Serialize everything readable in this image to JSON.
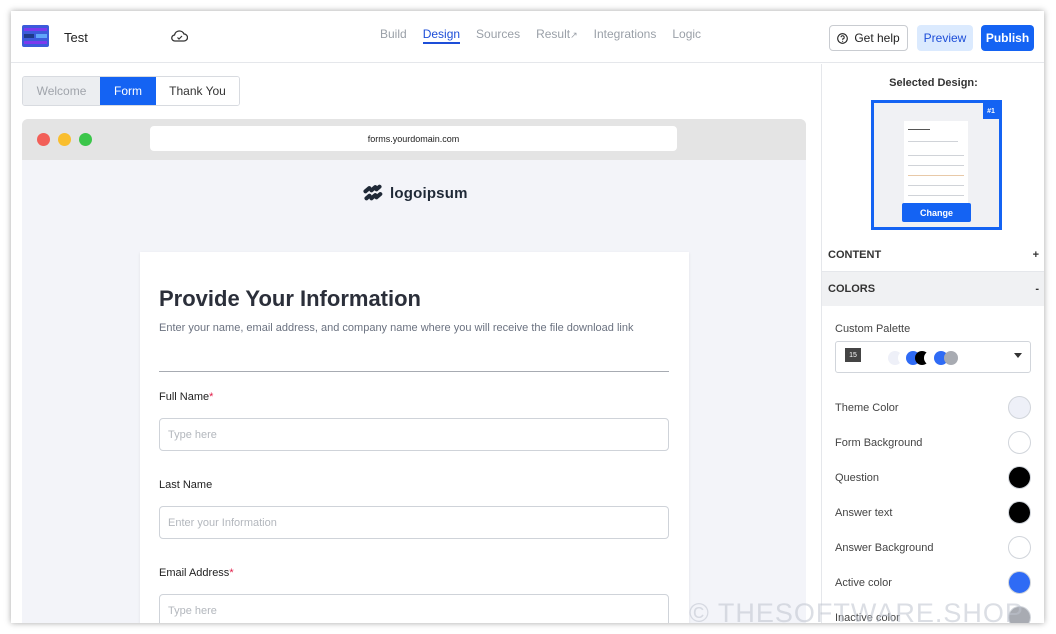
{
  "app": {
    "project_name": "Test"
  },
  "nav": [
    {
      "label": "Build"
    },
    {
      "label": "Design"
    },
    {
      "label": "Sources"
    },
    {
      "label": "Result"
    },
    {
      "label": "Integrations"
    },
    {
      "label": "Logic"
    }
  ],
  "actions": {
    "help": "Get help",
    "preview": "Preview",
    "publish": "Publish"
  },
  "page_tabs": [
    "Welcome",
    "Form",
    "Thank You"
  ],
  "browser": {
    "url": "forms.yourdomain.com"
  },
  "brand": {
    "name": "logoipsum"
  },
  "form": {
    "title": "Provide Your Information",
    "subtitle": "Enter your name, email address, and company name where you will receive the file download link",
    "fields": [
      {
        "label": "Full Name",
        "required": "*",
        "placeholder": "Type here"
      },
      {
        "label": "Last Name",
        "required": "",
        "placeholder": "Enter your Information"
      },
      {
        "label": "Email Address",
        "required": "*",
        "placeholder": "Type here"
      }
    ]
  },
  "panel": {
    "selected_design_title": "Selected Design:",
    "design_badge": "#1",
    "change_label": "Change",
    "sections": {
      "content": "CONTENT",
      "content_toggle": "+",
      "colors": "COLORS",
      "colors_toggle": "-"
    },
    "custom_palette_label": "Custom Palette",
    "palette_count": "15",
    "colors": [
      {
        "label": "Theme Color",
        "hex": "#eef0f8"
      },
      {
        "label": "Form Background",
        "hex": "#ffffff"
      },
      {
        "label": "Question",
        "hex": "#000000"
      },
      {
        "label": "Answer text",
        "hex": "#000000"
      },
      {
        "label": "Answer Background",
        "hex": "#ffffff"
      },
      {
        "label": "Active color",
        "hex": "#2f6bf5"
      },
      {
        "label": "Inactive color",
        "hex": "#a8abb2"
      }
    ]
  },
  "watermark": "© THESOFTWARE.SHOP"
}
